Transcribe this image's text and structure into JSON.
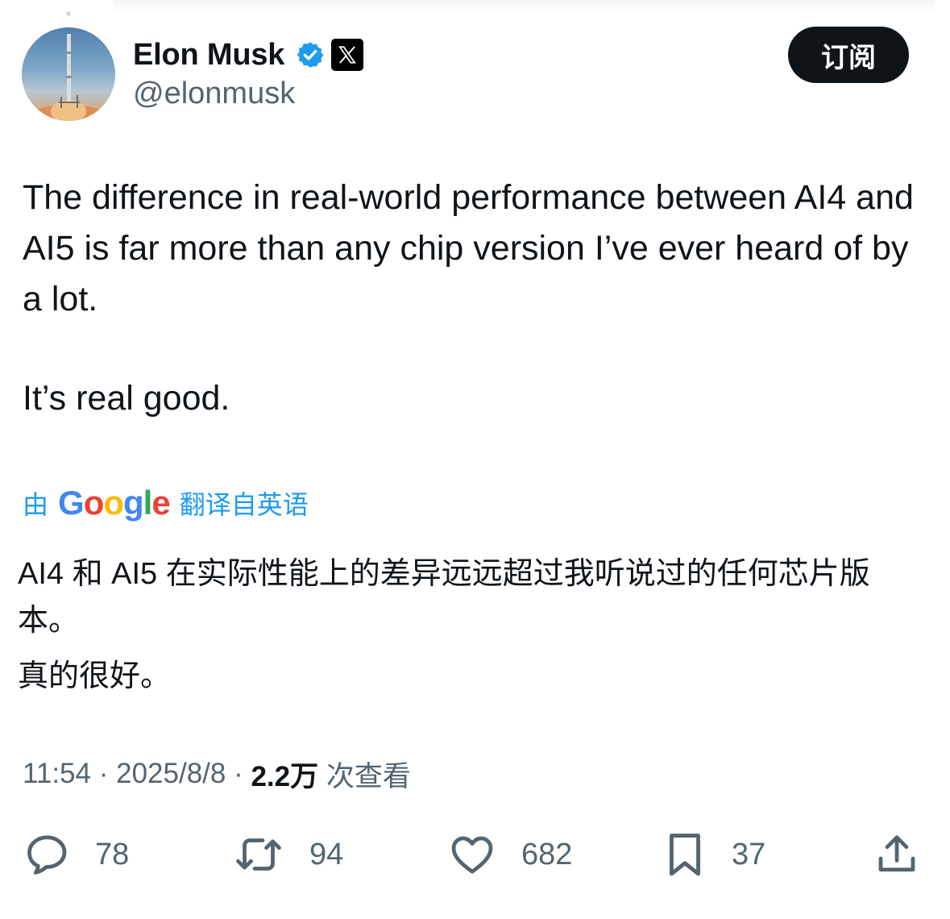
{
  "author": {
    "name": "Elon Musk",
    "handle": "@elonmusk"
  },
  "subscribe_label": "订阅",
  "tweet": {
    "paragraph1": "The difference in real-world performance between AI4 and AI5 is far more than any chip version I’ve ever heard of by a lot.",
    "paragraph2": "It’s real good."
  },
  "translation": {
    "prefix": "由",
    "provider": "Google",
    "suffix": "翻译自英语",
    "paragraph1": "AI4 和 AI5 在实际性能上的差异远远超过我听说过的任何芯片版本。",
    "paragraph2": "真的很好。"
  },
  "meta": {
    "time": "11:54",
    "separator": " · ",
    "date": "2025/8/8",
    "views_count": "2.2万",
    "views_label": " 次查看"
  },
  "actions": {
    "replies": "78",
    "reposts": "94",
    "likes": "682",
    "bookmarks": "37"
  },
  "icons": {
    "reply": "reply-icon",
    "repost": "repost-icon",
    "like": "heart-icon",
    "bookmark": "bookmark-icon",
    "share": "share-icon",
    "verified": "verified-badge-icon",
    "affiliate": "x-logo-icon"
  },
  "colors": {
    "link": "#1d9bf0",
    "secondary_text": "#536471",
    "primary_text": "#0f1419",
    "verified": "#1d9bf0"
  }
}
